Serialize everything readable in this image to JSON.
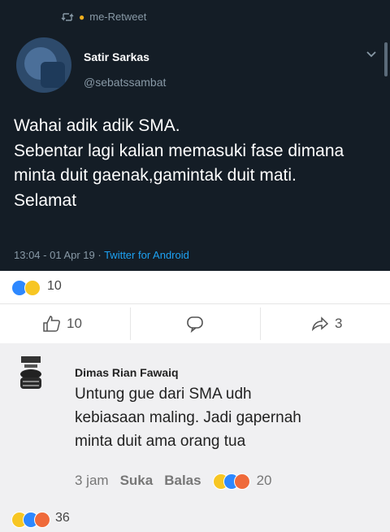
{
  "tweet": {
    "retweet_label": "me-Retweet",
    "display_name": "Satir Sarkas",
    "handle": "@sebatssambat",
    "text": "Wahai adik adik SMA.\nSebentar lagi kalian memasuki fase dimana minta duit gaenak,gamintak duit mati.\nSelamat",
    "timestamp": "13:04 - 01 Apr 19",
    "separator": " · ",
    "source": "Twitter for Android"
  },
  "post_reactions": {
    "count": "10"
  },
  "actions": {
    "like_count": "10",
    "share_count": "3"
  },
  "comment": {
    "author": "Dimas Rian Fawaiq",
    "text": "Untung gue dari SMA udh\nkebiasaan maling. Jadi gapernah\nminta duit ama orang tua",
    "time": "3 jam",
    "like_label": "Suka",
    "reply_label": "Balas",
    "reaction_count": "20"
  },
  "bottom_reactions": {
    "count": "36"
  },
  "colors": {
    "tweet_bg": "#141d26",
    "twitter_blue": "#1da1f2",
    "fb_like_blue": "#2d88ff"
  },
  "icons": [
    "retweet-icon",
    "chevron-down-icon",
    "thumbs-up-icon",
    "comment-icon",
    "share-icon"
  ]
}
